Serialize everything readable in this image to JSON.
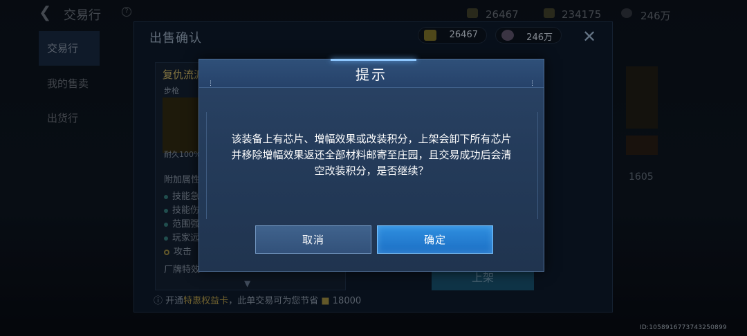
{
  "background": {
    "title": "交易行",
    "help": "?",
    "currencies": [
      "26467",
      "234175",
      "246万"
    ],
    "sidebar": [
      "交易行",
      "我的售卖",
      "出货行"
    ]
  },
  "sale_panel": {
    "title": "出售确认",
    "currency1": "26467",
    "currency2": "246万",
    "item_name": "复仇流派",
    "item_type": "步枪",
    "durability": "耐久100%",
    "attr_title": "附加属性",
    "attributes": [
      "技能急速",
      "技能伤害",
      "范围强化",
      "玩家远程",
      "攻击"
    ],
    "feature_label": "厂牌特效",
    "note_prefix": "开通",
    "note_link": "特惠权益卡",
    "note_suffix": "，此单交易可为您节省",
    "note_amount": "18000",
    "list_button": "上架",
    "right_value": "1605"
  },
  "id_stamp": "ID:1058916773743250899",
  "modal": {
    "title": "提示",
    "message_lines": [
      "该装备上有芯片、增幅效果或改装积分，上架会卸下所有芯片",
      "并移除增幅效果返还全部材料邮寄至庄园，且交易成功后会清",
      "空改装积分，是否继续？"
    ],
    "cancel_label": "取消",
    "confirm_label": "确定"
  },
  "colors": {
    "modal_bg": "#243b5a",
    "confirm_btn": "#1c6fc4",
    "cancel_btn": "#32517a"
  }
}
